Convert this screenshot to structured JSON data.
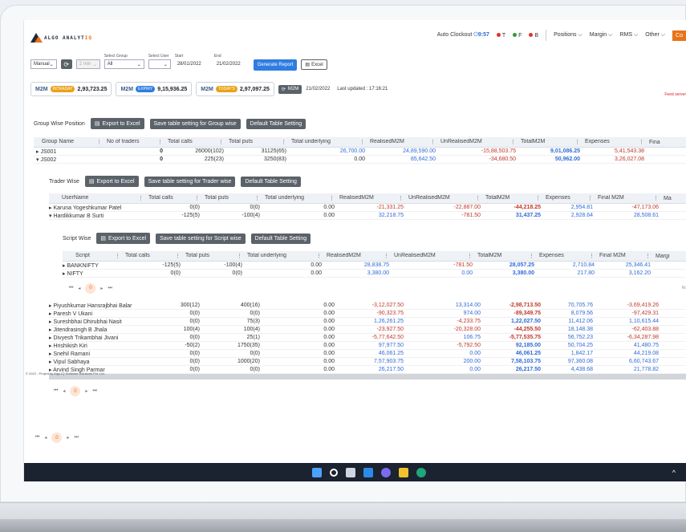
{
  "app": {
    "logo_text": "ALGO ANALYTIQ",
    "logo_left": "ALGO ANALYT",
    "logo_accent": "IQ"
  },
  "nav": {
    "auto_clockout_label": "Auto Clockout",
    "auto_clockout_time": "9:57",
    "t_label": "T",
    "f_label": "F",
    "b_label": "B",
    "items": [
      "Positions",
      "Margin",
      "RMS",
      "Other"
    ],
    "co_label": "Co"
  },
  "controls": {
    "mode": "Manual",
    "interval": "2 min",
    "group_label": "Select Group",
    "group_value": "All",
    "user_label": "Select User",
    "user_value": "",
    "start_label": "Start",
    "start_value": "28/01/2022",
    "end_label": "End",
    "end_value": "21/02/2022",
    "generate_label": "Generate Report",
    "excel_label": "Excel"
  },
  "m2m": {
    "intraday": {
      "title": "M2M",
      "badge": "INTRADAY",
      "value": "2,93,723.25"
    },
    "expiry": {
      "title": "M2M",
      "badge": "EXPIRY",
      "value": "9,15,936.25"
    },
    "todays": {
      "title": "M2M",
      "badge": "TODAY'S",
      "value": "2,97,097.25"
    },
    "refresh_label": "M2M",
    "date": "21/02/2022",
    "last_updated": "Last updated : 17:16:21",
    "feed_label": "Feed server"
  },
  "group_section": {
    "title": "Group Wise Position",
    "export_label": "Export to Excel",
    "save_label": "Save table setting for Group wise",
    "default_label": "Default Table Setting",
    "columns": [
      "Group Name",
      "No of traders",
      "Total calls",
      "Total puts",
      "Total underlying",
      "RealisedM2M",
      "UnRealisedM2M",
      "TotalM2M",
      "Expenses",
      "Fina"
    ],
    "rows": [
      {
        "arrow": "▸",
        "name": "JS001",
        "traders": "0",
        "calls": "26000(102)",
        "puts": "31125(65)",
        "underlying": "26,700.00",
        "realised": "24,89,590.00",
        "unrealised": "-15,88,503.75",
        "total": "9,01,086.25",
        "expenses": "5,41,543.38"
      },
      {
        "arrow": "▾",
        "name": "JS002",
        "traders": "0",
        "calls": "225(23)",
        "puts": "3250(83)",
        "underlying": "0.00",
        "realised": "85,642.50",
        "unrealised": "-34,680.50",
        "total": "50,962.00",
        "expenses": "3,26,027.08"
      }
    ]
  },
  "trader_section": {
    "title": "Trader Wise",
    "export_label": "Export to Excel",
    "save_label": "Save table setting for Trader wise",
    "default_label": "Default Table Setting",
    "columns": [
      "UserName",
      "Total calls",
      "Total puts",
      "Total underlying",
      "RealisedM2M",
      "UnRealisedM2M",
      "TotalM2M",
      "Expenses",
      "Final M2M",
      "Ma"
    ],
    "rows_top": [
      {
        "arrow": "▸",
        "name": "Karuna Yogeshkumar Patel",
        "calls": "0(0)",
        "puts": "0(0)",
        "underlying": "0.00",
        "realised": "-21,331.25",
        "unrealised": "-22,887.00",
        "total": "-44,218.25",
        "expenses": "2,954.81",
        "final": "-47,173.06"
      },
      {
        "arrow": "▾",
        "name": "Hardikkumar B Surti",
        "calls": "-125(5)",
        "puts": "-100(4)",
        "underlying": "0.00",
        "realised": "32,218.75",
        "unrealised": "-781.50",
        "total": "31,437.25",
        "expenses": "2,928.64",
        "final": "28,508.61"
      }
    ],
    "rows_bottom": [
      {
        "arrow": "▸",
        "name": "Piyushkumar Hansrajbhai Balar",
        "calls": "300(12)",
        "puts": "400(16)",
        "underlying": "0.00",
        "realised": "-3,12,027.50",
        "unrealised": "13,314.00",
        "total": "-2,98,713.50",
        "expenses": "70,705.76",
        "final": "-3,69,419.26"
      },
      {
        "arrow": "▸",
        "name": "Paresh V Ukani",
        "calls": "0(0)",
        "puts": "0(0)",
        "underlying": "0.00",
        "realised": "-90,323.75",
        "unrealised": "974.00",
        "total": "-89,349.75",
        "expenses": "8,079.56",
        "final": "-97,429.31"
      },
      {
        "arrow": "▸",
        "name": "Sureshbhai Dhirubhai Nasit",
        "calls": "0(0)",
        "puts": "75(3)",
        "underlying": "0.00",
        "realised": "1,26,261.25",
        "unrealised": "-4,233.75",
        "total": "1,22,027.50",
        "expenses": "11,412.06",
        "final": "1,10,615.44"
      },
      {
        "arrow": "▸",
        "name": "Jitendrasingh B Jhala",
        "calls": "100(4)",
        "puts": "100(4)",
        "underlying": "0.00",
        "realised": "-23,927.50",
        "unrealised": "-20,328.00",
        "total": "-44,255.50",
        "expenses": "18,148.38",
        "final": "-62,403.88"
      },
      {
        "arrow": "▸",
        "name": "Divyesh Trikambhai Jivani",
        "calls": "0(0)",
        "puts": "25(1)",
        "underlying": "0.00",
        "realised": "-5,77,642.50",
        "unrealised": "106.75",
        "total": "-5,77,535.75",
        "expenses": "56,752.23",
        "final": "-6,34,287.98"
      },
      {
        "arrow": "▸",
        "name": "Hrishikish Kiri",
        "calls": "-50(2)",
        "puts": "1750(35)",
        "underlying": "0.00",
        "realised": "97,977.50",
        "unrealised": "-5,792.50",
        "total": "92,185.00",
        "expenses": "50,704.25",
        "final": "41,480.75"
      },
      {
        "arrow": "▸",
        "name": "Snehil Ramani",
        "calls": "0(0)",
        "puts": "0(0)",
        "underlying": "0.00",
        "realised": "46,061.25",
        "unrealised": "0.00",
        "total": "46,061.25",
        "expenses": "1,842.17",
        "final": "44,219.08"
      },
      {
        "arrow": "▸",
        "name": "Vipul Sabhaya",
        "calls": "0(0)",
        "puts": "1000(20)",
        "underlying": "0.00",
        "realised": "7,57,903.75",
        "unrealised": "200.00",
        "total": "7,58,103.75",
        "expenses": "97,360.08",
        "final": "6,60,743.67"
      },
      {
        "arrow": "▸",
        "name": "Arvind Singh Parmar",
        "calls": "0(0)",
        "puts": "0(0)",
        "underlying": "0.00",
        "realised": "26,217.50",
        "unrealised": "0.00",
        "total": "26,217.50",
        "expenses": "4,438.68",
        "final": "21,778.82"
      }
    ]
  },
  "script_section": {
    "title": "Script Wise",
    "export_label": "Export to Excel",
    "save_label": "Save table setting for Script wise",
    "default_label": "Default Table Setting",
    "columns": [
      "Script",
      "Total calls",
      "Total puts",
      "Total underlying",
      "RealisedM2M",
      "UnRealisedM2M",
      "TotalM2M",
      "Expenses",
      "Final M2M",
      "Margi"
    ],
    "rows": [
      {
        "arrow": "▸",
        "name": "BANKNIFTY",
        "calls": "-125(5)",
        "puts": "-100(4)",
        "underlying": "0.00",
        "realised": "28,838.75",
        "unrealised": "-781.50",
        "total": "28,057.25",
        "expenses": "2,710.84",
        "final": "25,346.41"
      },
      {
        "arrow": "▸",
        "name": "NIFTY",
        "calls": "0(0)",
        "puts": "0(0)",
        "underlying": "0.00",
        "realised": "3,380.00",
        "unrealised": "0.00",
        "total": "3,380.00",
        "expenses": "217.80",
        "final": "3,162.20"
      }
    ],
    "no_label": "No"
  },
  "pagination": {
    "current": "0",
    "first": "⏮",
    "prev": "◂",
    "next": "▸",
    "last": "⏭"
  },
  "copyright": "© 2022 - Project by Algo IQ Software Solutions Pvt. Ltd.",
  "colors": {
    "accent": "#e8731a",
    "blue": "#2f6bd6",
    "red": "#c0392b",
    "gray_button": "#5b6269"
  },
  "taskbar": {
    "icons": [
      "windows-icon",
      "search-icon",
      "task-view-icon",
      "widgets-icon",
      "chat-icon",
      "file-explorer-icon",
      "edge-icon"
    ],
    "tray": "^"
  }
}
